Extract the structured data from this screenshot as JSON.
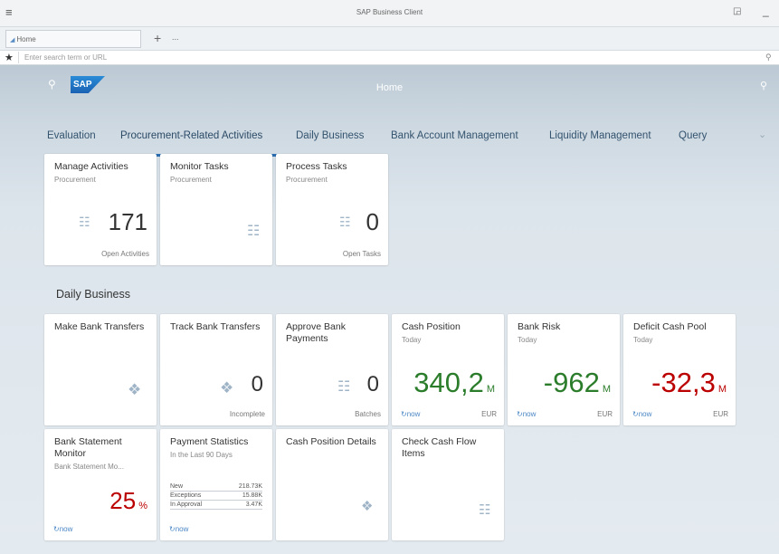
{
  "window": {
    "menu_icon": "hamburger-icon",
    "title": "SAP Business Client",
    "minimize_label": "_"
  },
  "tabs": {
    "home_label": "Home",
    "plus_label": "+",
    "more_label": "..."
  },
  "address": {
    "placeholder": "Enter search term or URL",
    "favorite_icon": "star-icon",
    "search_icon": "search-icon"
  },
  "shell": {
    "title": "Home",
    "logo_text": "SAP"
  },
  "nav": {
    "tabs": [
      "Evaluation",
      "Procurement-Related Activities",
      "Daily Business",
      "Bank Account Management",
      "Liquidity Management",
      "Query"
    ],
    "active_index": 1
  },
  "procurement_tiles": [
    {
      "title": "Manage Activities",
      "subtitle": "Procurement",
      "value": "171",
      "footer": "Open Activities"
    },
    {
      "title": "Monitor Tasks",
      "subtitle": "Procurement"
    },
    {
      "title": "Process Tasks",
      "subtitle": "Procurement",
      "value": "0",
      "footer": "Open Tasks"
    }
  ],
  "daily_business": {
    "section_title": "Daily Business",
    "tiles": [
      {
        "title": "Make Bank Transfers"
      },
      {
        "title": "Track Bank Transfers",
        "value": "0",
        "footer": "Incomplete"
      },
      {
        "title": "Approve Bank Payments",
        "value": "0",
        "footer": "Batches"
      },
      {
        "title": "Cash Position",
        "subtitle": "Today",
        "value": "340,2",
        "scale": "M",
        "refresh": "now",
        "currency": "EUR",
        "color": "#2b7d2b"
      },
      {
        "title": "Bank Risk",
        "subtitle": "Today",
        "value": "-962",
        "scale": "M",
        "refresh": "now",
        "currency": "EUR",
        "color": "#2b7d2b"
      },
      {
        "title": "Deficit Cash Pool",
        "subtitle": "Today",
        "value": "-32,3",
        "scale": "M",
        "refresh": "now",
        "currency": "EUR",
        "color": "#bb0000"
      },
      {
        "title": "Bank Statement Monitor",
        "subtitle": "Bank Statement Mo...",
        "value": "25",
        "scale": "%",
        "refresh": "now",
        "color": "#bb0000"
      },
      {
        "title": "Payment Statistics",
        "subtitle": "In the Last 90 Days",
        "refresh": "now",
        "rows": [
          {
            "label": "New",
            "value": "218.73K"
          },
          {
            "label": "Exceptions",
            "value": "15.88K"
          },
          {
            "label": "In Approval",
            "value": "3.47K"
          }
        ]
      },
      {
        "title": "Cash Position Details"
      },
      {
        "title": "Check Cash Flow Items"
      }
    ]
  }
}
